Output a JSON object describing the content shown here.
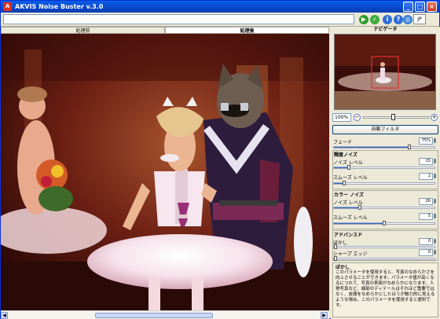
{
  "window": {
    "title": "AKVIS Noise Buster v.3.0",
    "title_controls": [
      "_",
      "□",
      "×"
    ]
  },
  "toolbar": {
    "path_value": "",
    "buttons": [
      {
        "name": "go-button",
        "glyph": "▶",
        "color": "#2E9C2E"
      },
      {
        "name": "ok-button",
        "glyph": "✓",
        "color": "#3DAA3D"
      },
      {
        "name": "info-button",
        "glyph": "i",
        "color": "#2F6ED9"
      },
      {
        "name": "help-button",
        "glyph": "?",
        "color": "#2F6ED9"
      },
      {
        "name": "settings-button",
        "glyph": "◎",
        "color": "#3A82D8"
      }
    ],
    "language_label": "JP"
  },
  "tabs": [
    {
      "label": "処理前",
      "active": false
    },
    {
      "label": "処理後",
      "active": true
    }
  ],
  "panel": {
    "navigator_title": "ナビゲータ",
    "zoom_value": "100%",
    "zoom_minus": "−",
    "zoom_plus": "+",
    "zoom_level": 0.45,
    "auto_filter_label": "自動フィルタ",
    "fade": {
      "label": "フェード",
      "value": "75%",
      "level": 0.75
    },
    "luminance": {
      "title": "輝度ノイズ",
      "noise": {
        "label": "ノイズ レベル",
        "value": "15",
        "level": 0.15
      },
      "smooth": {
        "label": "スムーズ レベル",
        "value": "2",
        "level": 0.1
      }
    },
    "color": {
      "title": "カラー ノイズ",
      "noise": {
        "label": "ノイズ レベル",
        "value": "26",
        "level": 0.26
      },
      "smooth": {
        "label": "スムーズ レベル",
        "value": "5",
        "level": 0.5
      }
    },
    "advanced": {
      "title": "アドバンスド",
      "blur": {
        "label": "ぼかし",
        "value": "0",
        "level": 0
      },
      "sharpen": {
        "label": "シャープ エッジ",
        "value": "0",
        "level": 0
      }
    },
    "help": {
      "title": "ぼかし",
      "text": "このパラメータを使用すると、写真のなめらかさを向上させることができます。パラメータ値が高くなるにつれて、写真の表面がなめらかになります。人物写真など、細部のディテールはそれほど重要ではなく、皮膚をなめらかにしたほうが魅力的に見えるような場合、このパラメータを使用すると便利です。"
    }
  }
}
